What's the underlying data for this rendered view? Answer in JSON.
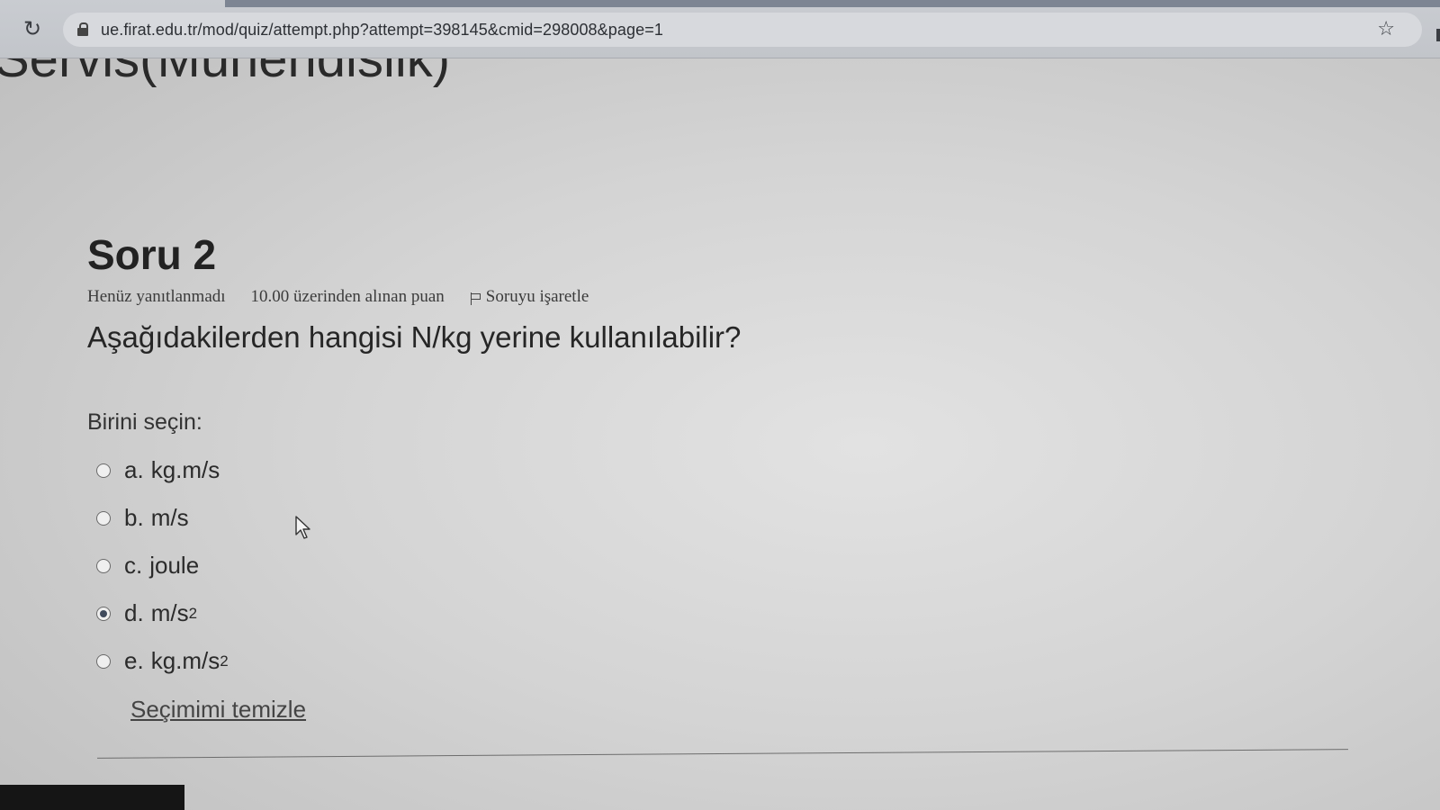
{
  "browser": {
    "url": "ue.firat.edu.tr/mod/quiz/attempt.php?attempt=398145&cmid=298008&page=1",
    "reload_icon": "reload-icon",
    "lock_icon": "lock-icon",
    "star_icon": "star-icon"
  },
  "course": {
    "heading": "Servis(Mühendislik)"
  },
  "question": {
    "title": "Soru 2",
    "status": "Henüz yanıtlanmadı",
    "grade": "10.00 üzerinden alınan puan",
    "flag_label": "Soruyu işaretle",
    "text": "Aşağıdakilerden hangisi N/kg yerine kullanılabilir?",
    "prompt": "Birini seçin:",
    "options": [
      {
        "letter": "a.",
        "label": "kg.m/s",
        "sup": "",
        "selected": false
      },
      {
        "letter": "b.",
        "label": "m/s",
        "sup": "",
        "selected": false
      },
      {
        "letter": "c.",
        "label": "joule",
        "sup": "",
        "selected": false
      },
      {
        "letter": "d.",
        "label": "m/s",
        "sup": "2",
        "selected": true
      },
      {
        "letter": "e.",
        "label": "kg.m/s",
        "sup": "2",
        "selected": false
      }
    ],
    "clear_label": "Seçimimi temizle"
  }
}
